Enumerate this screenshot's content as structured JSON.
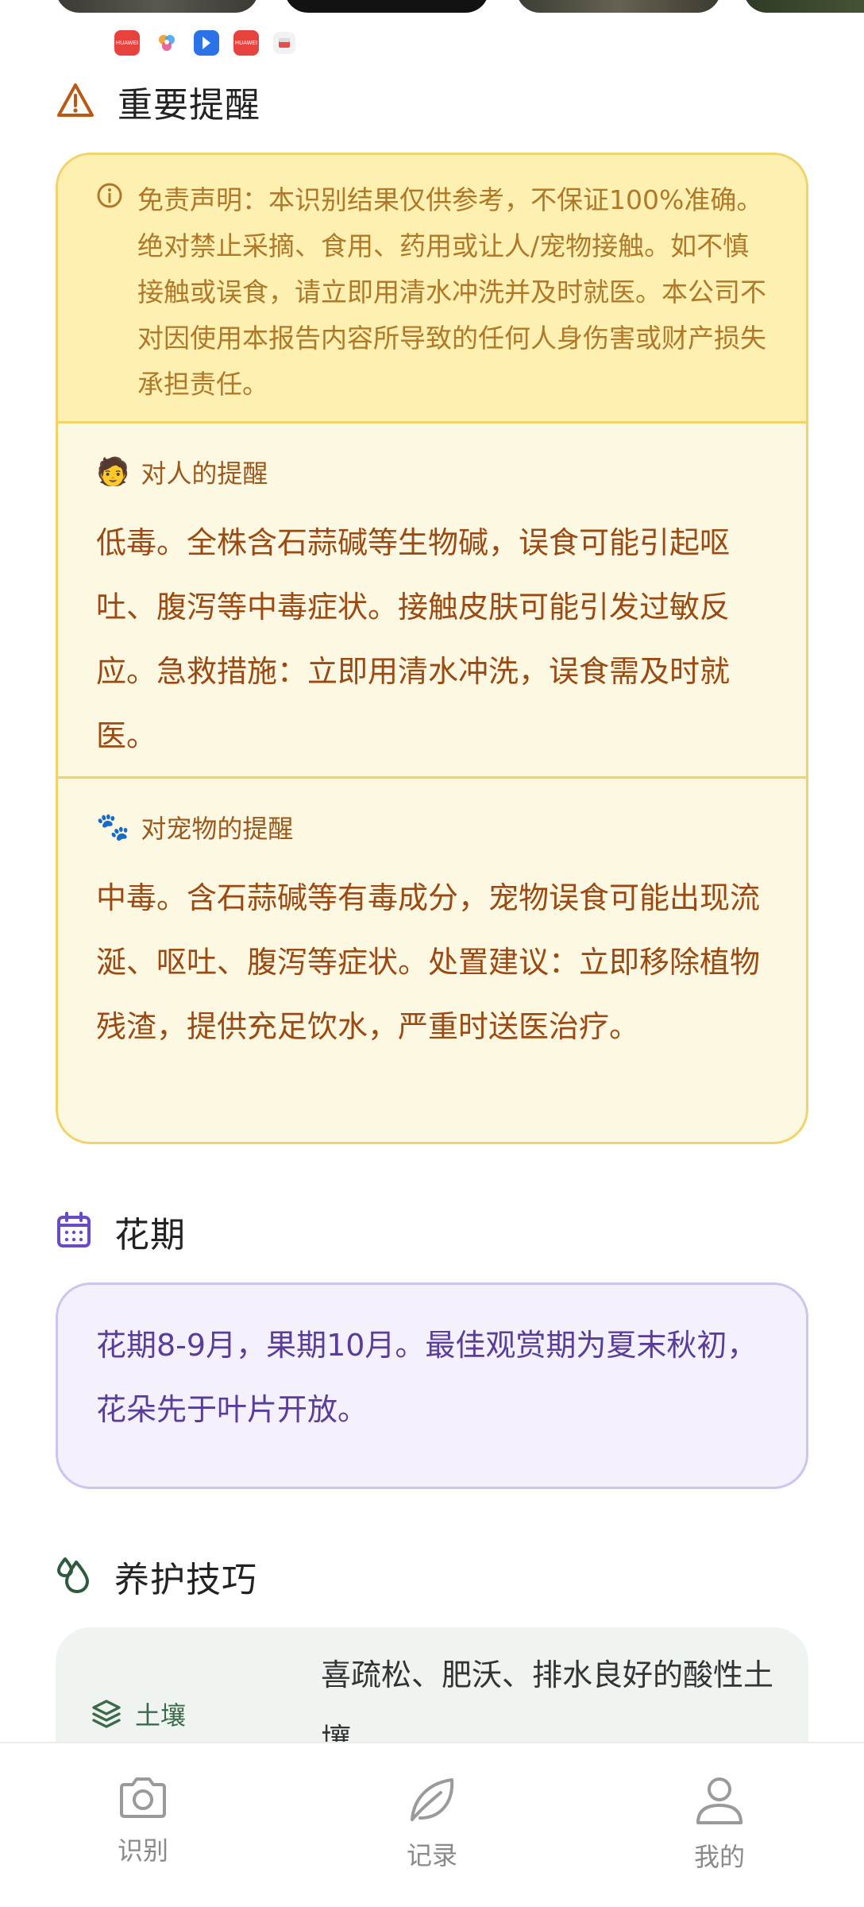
{
  "apps": [
    "HUAWEI",
    "",
    "",
    "HUAWEI",
    ""
  ],
  "sections": {
    "warning": {
      "title": "重要提醒",
      "disclaimer": "免责声明：本识别结果仅供参考，不保证100%准确。绝对禁止采摘、食用、药用或让人/宠物接触。如不慎接触或误食，请立即用清水冲洗并及时就医。本公司不对因使用本报告内容所导致的任何人身伤害或财产损失承担责任。",
      "human": {
        "emoji": "🧑",
        "title": "对人的提醒",
        "body": "低毒。全株含石蒜碱等生物碱，误食可能引起呕吐、腹泻等中毒症状。接触皮肤可能引发过敏反应。急救措施：立即用清水冲洗，误食需及时就医。"
      },
      "pet": {
        "emoji": "🐾",
        "title": "对宠物的提醒",
        "body": "中毒。含石蒜碱等有毒成分，宠物误食可能出现流涎、呕吐、腹泻等症状。处置建议：立即移除植物残渣，提供充足饮水，严重时送医治疗。"
      }
    },
    "flowering": {
      "title": "花期",
      "body": "花期8-9月，果期10月。最佳观赏期为夏末秋初，花朵先于叶片开放。"
    },
    "care": {
      "title": "养护技巧",
      "soil_label": "土壤",
      "soil_value": "喜疏松、肥沃、排水良好的酸性土壤"
    }
  },
  "nav": {
    "identify": "识别",
    "records": "记录",
    "mine": "我的"
  },
  "colors": {
    "warning_accent": "#b0792a",
    "flower_accent": "#6a4bc4",
    "care_accent": "#3a6a4a"
  }
}
